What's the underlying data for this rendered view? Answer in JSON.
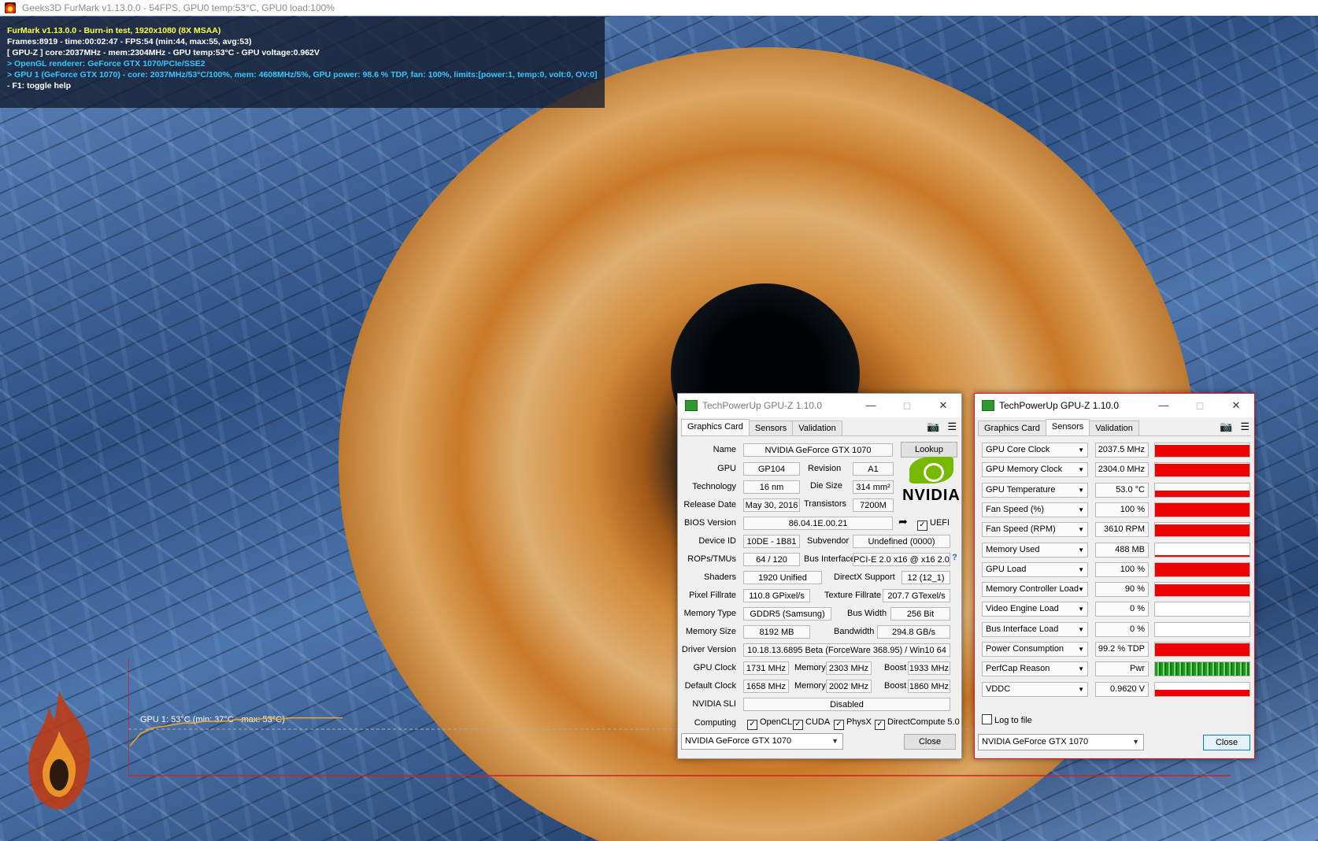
{
  "furmark": {
    "window_title": "Geeks3D FurMark v1.13.0.0 - 54FPS, GPU0 temp:53°C, GPU0 load:100%",
    "hud_lines": [
      {
        "text": "FurMark v1.13.0.0 - Burn-in test, 1920x1080 (8X MSAA)",
        "color": "#ffff3c"
      },
      {
        "text": "Frames:8919 - time:00:02:47 - FPS:54 (min:44, max:55, avg:53)",
        "color": "#ffffff"
      },
      {
        "text": "[ GPU-Z ] core:2037MHz - mem:2304MHz - GPU temp:53°C - GPU voltage:0.962V",
        "color": "#ffffff"
      },
      {
        "text": "> OpenGL renderer: GeForce GTX 1070/PCIe/SSE2",
        "color": "#35c7ff"
      },
      {
        "text": "> GPU 1 (GeForce GTX 1070) - core: 2037MHz/53°C/100%, mem: 4608MHz/5%, GPU power: 98.6 % TDP, fan: 100%, limits:[power:1, temp:0, volt:0, OV:0]",
        "color": "#35c7ff"
      },
      {
        "text": "- F1: toggle help",
        "color": "#ffffff"
      }
    ],
    "temp_graph": {
      "label": "GPU 1: 53°C (min: 37°C - max: 53°C)",
      "line_color": "#f5a623",
      "temps_c": [
        37,
        44,
        47,
        48,
        49,
        50,
        50,
        51,
        51,
        51,
        52,
        52,
        52,
        53,
        52,
        53,
        53,
        53,
        53,
        53,
        53
      ]
    },
    "logo_icon": "furmark-flame-icon"
  },
  "gpuz_card": {
    "title": "TechPowerUp GPU-Z 1.10.0",
    "tabs": [
      "Graphics Card",
      "Sensors",
      "Validation"
    ],
    "selected_tab": "Graphics Card",
    "name_label": "Name",
    "name": "NVIDIA GeForce GTX 1070",
    "lookup_label": "Lookup",
    "gpu_label": "GPU",
    "gpu": "GP104",
    "revision_label": "Revision",
    "revision": "A1",
    "technology_label": "Technology",
    "technology": "16 nm",
    "die_size_label": "Die Size",
    "die_size": "314 mm²",
    "release_date_label": "Release Date",
    "release_date": "May 30, 2016",
    "transistors_label": "Transistors",
    "transistors": "7200M",
    "bios_label": "BIOS Version",
    "bios": "86.04.1E.00.21",
    "uefi_label": "UEFI",
    "device_id_label": "Device ID",
    "device_id": "10DE - 1B81",
    "subvendor_label": "Subvendor",
    "subvendor": "Undefined (0000)",
    "rops_label": "ROPs/TMUs",
    "rops": "64 / 120",
    "bus_label": "Bus Interface",
    "bus": "PCI-E 2.0 x16 @ x16 2.0",
    "shaders_label": "Shaders",
    "shaders": "1920 Unified",
    "directx_label": "DirectX Support",
    "directx": "12 (12_1)",
    "pixel_fill_label": "Pixel Fillrate",
    "pixel_fill": "110.8 GPixel/s",
    "texture_fill_label": "Texture Fillrate",
    "texture_fill": "207.7 GTexel/s",
    "memory_type_label": "Memory Type",
    "memory_type": "GDDR5 (Samsung)",
    "bus_width_label": "Bus Width",
    "bus_width": "256 Bit",
    "memory_size_label": "Memory Size",
    "memory_size": "8192 MB",
    "bandwidth_label": "Bandwidth",
    "bandwidth": "294.8 GB/s",
    "driver_label": "Driver Version",
    "driver": "10.18.13.6895 Beta (ForceWare 368.95) / Win10 64",
    "gpu_clock_label": "GPU Clock",
    "gpu_clock": "1731 MHz",
    "memory_label": "Memory",
    "memory_clock": "2303 MHz",
    "boost_label": "Boost",
    "boost": "1933 MHz",
    "default_clock_label": "Default Clock",
    "default_clock": "1658 MHz",
    "default_memory": "2002 MHz",
    "default_boost": "1860 MHz",
    "sli_label": "NVIDIA SLI",
    "sli": "Disabled",
    "computing_label": "Computing",
    "opencl": "OpenCL",
    "cuda": "CUDA",
    "physx": "PhysX",
    "directcompute": "DirectCompute 5.0",
    "selected_gpu": "NVIDIA GeForce GTX 1070",
    "close_label": "Close",
    "nvidia_logo_text": "NVIDIA"
  },
  "gpuz_sensors": {
    "title": "TechPowerUp GPU-Z 1.10.0",
    "tabs": [
      "Graphics Card",
      "Sensors",
      "Validation"
    ],
    "selected_tab": "Sensors",
    "sensors": [
      {
        "name": "GPU Core Clock",
        "value": "2037.5 MHz",
        "level": 0.9
      },
      {
        "name": "GPU Memory Clock",
        "value": "2304.0 MHz",
        "level": 0.95
      },
      {
        "name": "GPU Temperature",
        "value": "53.0 °C",
        "level": 0.45
      },
      {
        "name": "Fan Speed (%)",
        "value": "100 %",
        "level": 1.0
      },
      {
        "name": "Fan Speed (RPM)",
        "value": "3610 RPM",
        "level": 0.9
      },
      {
        "name": "Memory Used",
        "value": "488 MB",
        "level": 0.08
      },
      {
        "name": "GPU Load",
        "value": "100 %",
        "level": 1.0
      },
      {
        "name": "Memory Controller Load",
        "value": "90 %",
        "level": 0.9
      },
      {
        "name": "Video Engine Load",
        "value": "0 %",
        "level": 0
      },
      {
        "name": "Bus Interface Load",
        "value": "0 %",
        "level": 0
      },
      {
        "name": "Power Consumption",
        "value": "99.2 % TDP",
        "level": 0.95
      },
      {
        "name": "PerfCap Reason",
        "value": "Pwr",
        "level": 1.0,
        "green": true
      },
      {
        "name": "VDDC",
        "value": "0.9620 V",
        "level": 0.45
      }
    ],
    "log_label": "Log to file",
    "selected_gpu": "NVIDIA GeForce GTX 1070",
    "close_label": "Close"
  },
  "colors": {
    "bar_red": "#ee0000",
    "nvidia_green": "#76b900",
    "active_border": "#e81123"
  }
}
